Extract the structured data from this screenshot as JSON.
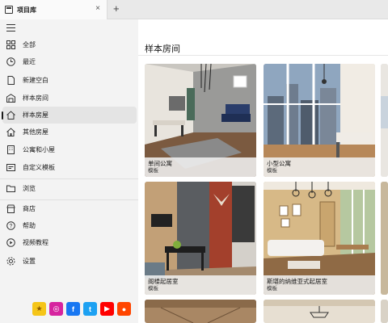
{
  "tab": {
    "title": "项目库",
    "close": "×",
    "new": "+"
  },
  "sidebar": {
    "items": [
      {
        "label": "全部",
        "icon": "grid-icon"
      },
      {
        "label": "最近",
        "icon": "clock-icon"
      },
      {
        "label": "新建空白",
        "icon": "document-icon"
      },
      {
        "label": "样本房间",
        "icon": "room-icon"
      },
      {
        "label": "样本房屋",
        "icon": "house-icon"
      },
      {
        "label": "其他房屋",
        "icon": "house-icon"
      },
      {
        "label": "公寓和小屋",
        "icon": "building-icon"
      },
      {
        "label": "自定义模板",
        "icon": "template-icon"
      },
      {
        "label": "浏览",
        "icon": "folder-icon"
      },
      {
        "label": "商店",
        "icon": "store-icon"
      },
      {
        "label": "帮助",
        "icon": "help-icon"
      },
      {
        "label": "视频教程",
        "icon": "play-icon"
      },
      {
        "label": "设置",
        "icon": "gear-icon"
      }
    ],
    "active_index": 4
  },
  "main": {
    "section_title": "样本房间",
    "cards": [
      {
        "name": "单间公寓",
        "type": "模板"
      },
      {
        "name": "小型公寓",
        "type": "模板"
      },
      {
        "name": "阁楼起居室",
        "type": "模板"
      },
      {
        "name": "斯堪的纳维亚式起居室",
        "type": "模板"
      }
    ]
  },
  "socials": [
    {
      "name": "star-icon",
      "glyph": "★",
      "color": "#f5c518"
    },
    {
      "name": "instagram-icon",
      "glyph": "◎",
      "color": "#d6249f"
    },
    {
      "name": "facebook-icon",
      "glyph": "f",
      "color": "#1877f2"
    },
    {
      "name": "twitter-icon",
      "glyph": "t",
      "color": "#1da1f2"
    },
    {
      "name": "youtube-icon",
      "glyph": "▶",
      "color": "#ff0000"
    },
    {
      "name": "reddit-icon",
      "glyph": "●",
      "color": "#ff4500"
    }
  ]
}
